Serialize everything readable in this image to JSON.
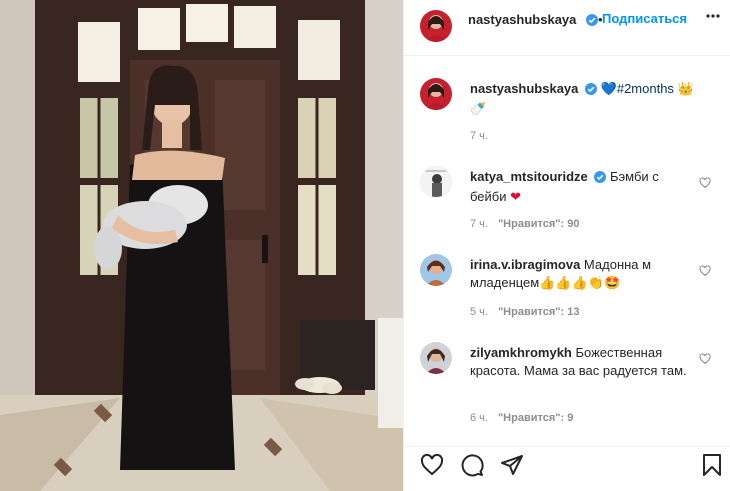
{
  "post": {
    "author": "nastyashubskaya",
    "follow_label": "Подписаться",
    "more_label": "•••"
  },
  "caption": {
    "username": "nastyashubskaya",
    "hashtag": "#2months",
    "time": "7 ч."
  },
  "comments": [
    {
      "username": "katya_mtsitouridze",
      "text": "Бэмби с бейби",
      "time": "7 ч.",
      "likes": "\"Нравится\": 90"
    },
    {
      "username": "irina.v.ibragimova",
      "text": "Мадонна м младенцем",
      "time": "5 ч.",
      "likes": "\"Нравится\": 13"
    },
    {
      "username": "zilyamkhromykh",
      "text": "Божественная красота. Мама за вас радуется там.",
      "time": "6 ч.",
      "likes": "\"Нравится\": 9"
    }
  ],
  "icons": {
    "heart": "heart-icon",
    "comment": "comment-icon",
    "share": "share-icon",
    "save": "bookmark-icon",
    "verified": "verified-badge-icon",
    "more": "more-icon"
  },
  "colors": {
    "link_blue": "#0095f6",
    "verified_blue": "#3897f0",
    "meta_gray": "#8e8e8e",
    "text": "#262626"
  }
}
